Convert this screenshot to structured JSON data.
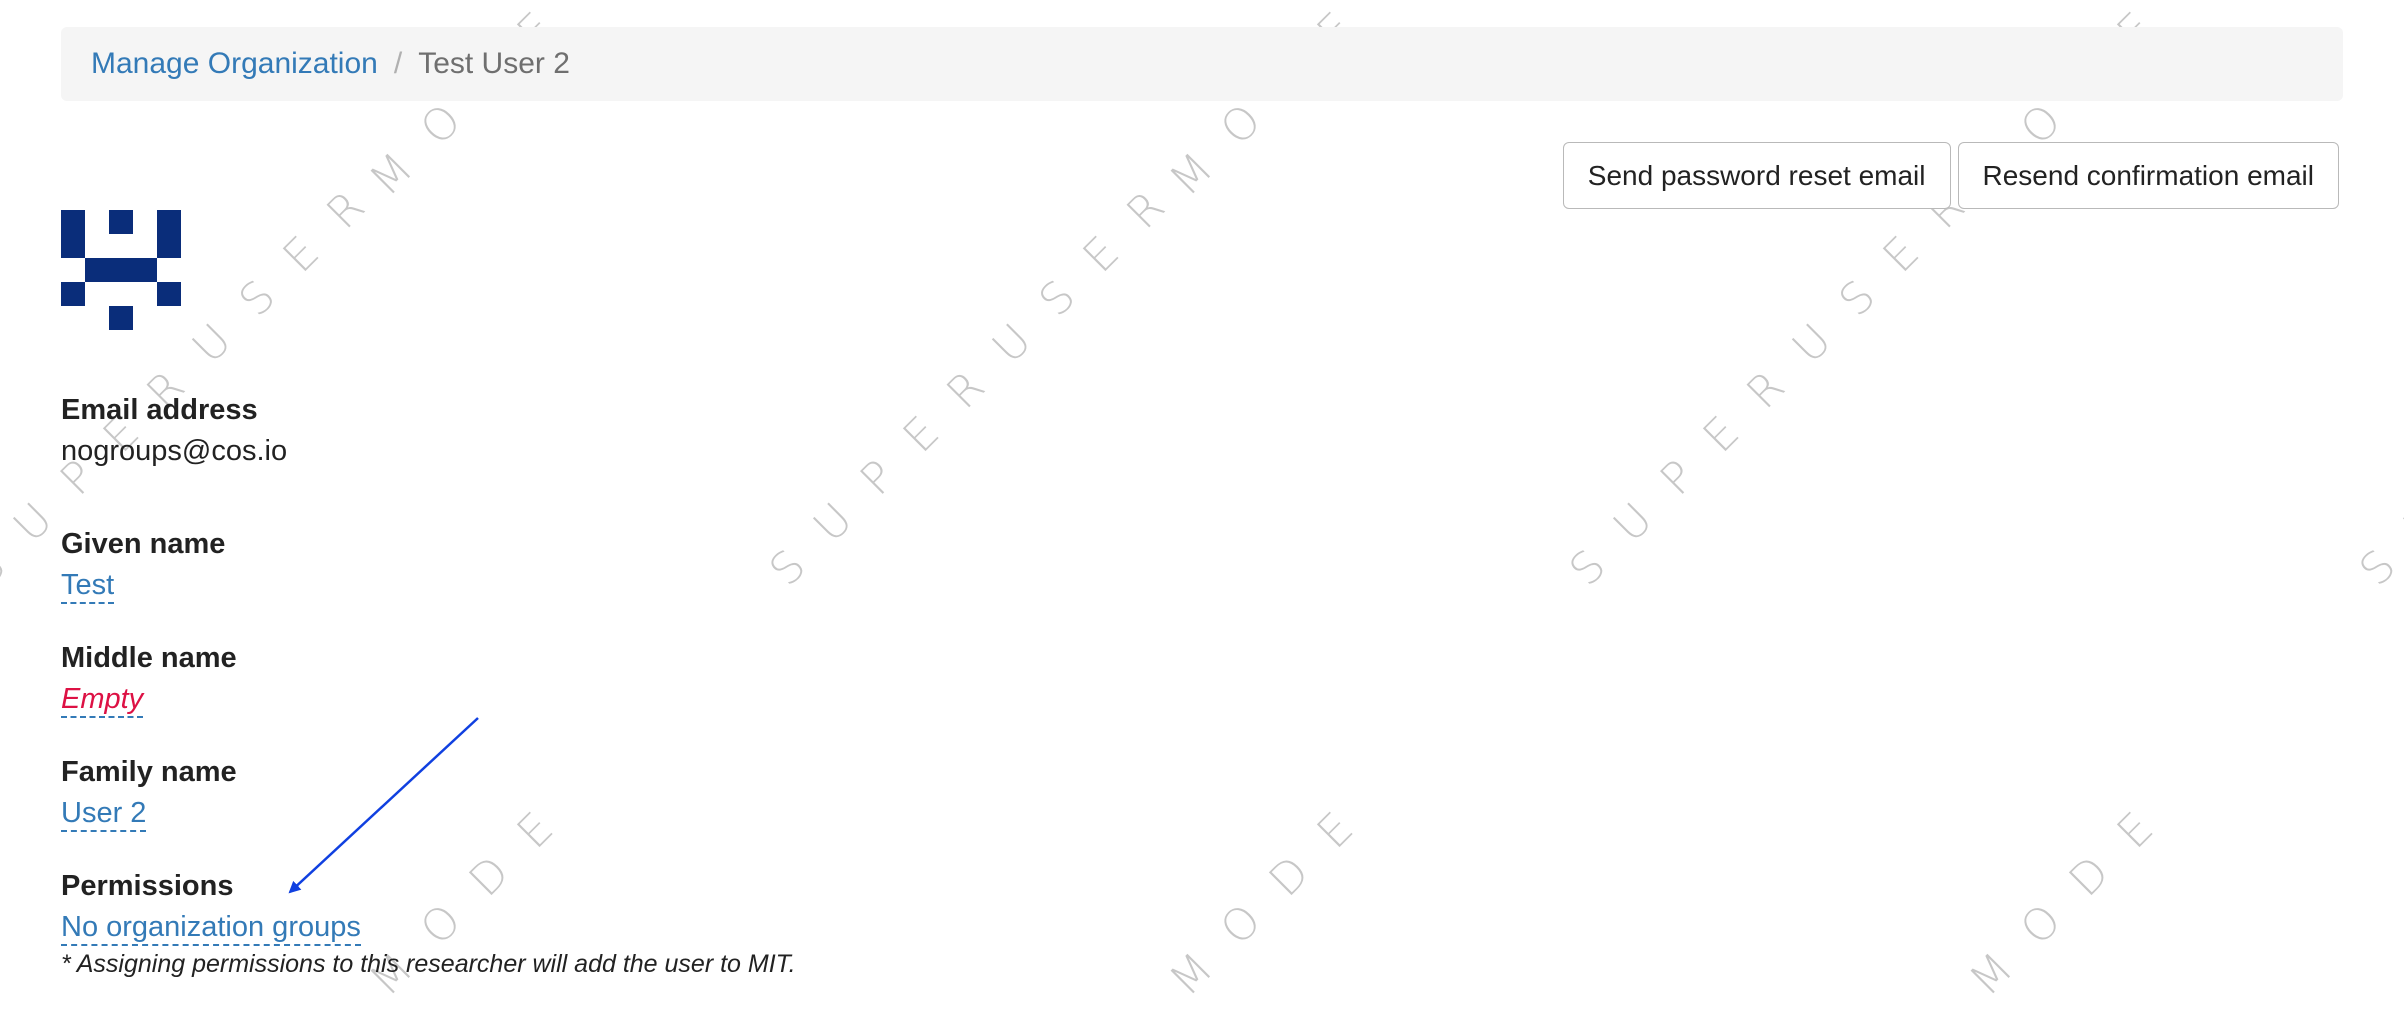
{
  "breadcrumb": {
    "root": "Manage Organization",
    "separator": "/",
    "current": "Test User 2"
  },
  "actions": {
    "reset_password": "Send password reset email",
    "resend_confirmation": "Resend confirmation email"
  },
  "watermark": {
    "line1": "SUPERUSER",
    "line2": "MODE"
  },
  "fields": {
    "email": {
      "label": "Email address",
      "value": "nogroups@cos.io"
    },
    "given_name": {
      "label": "Given name",
      "value": "Test"
    },
    "middle_name": {
      "label": "Middle name",
      "value": "Empty"
    },
    "family_name": {
      "label": "Family name",
      "value": "User 2"
    },
    "permissions": {
      "label": "Permissions",
      "value": "No organization groups"
    }
  },
  "note": "* Assigning permissions to this researcher will add the user to MIT.",
  "colors": {
    "link": "#337ab7",
    "empty": "#dd1144",
    "avatar": "#0a2d7a",
    "arrow": "#1040e0",
    "breadcrumb_bg": "#f5f5f5"
  },
  "icons": {
    "avatar": "identicon",
    "annotation": "arrow-annotation"
  }
}
